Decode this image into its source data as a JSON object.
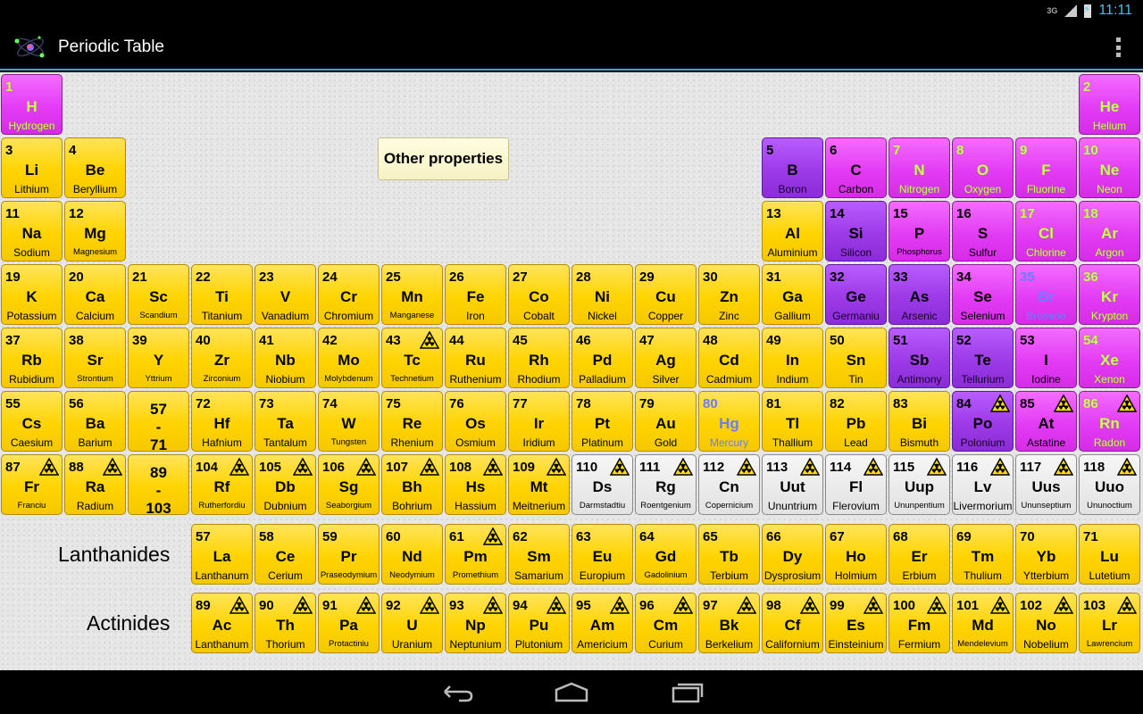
{
  "status": {
    "network": "3G",
    "time": "11:11"
  },
  "app": {
    "title": "Periodic Table"
  },
  "other_properties_label": "Other properties",
  "series": {
    "lanthanides": "Lanthanides",
    "actinides": "Actinides"
  },
  "elements": [
    {
      "n": "1",
      "s": "H",
      "name": "Hydrogen",
      "row": 0,
      "col": 0,
      "c": "magenta",
      "gas": true
    },
    {
      "n": "2",
      "s": "He",
      "name": "Helium",
      "row": 0,
      "col": 17,
      "c": "magenta",
      "gas": true
    },
    {
      "n": "3",
      "s": "Li",
      "name": "Lithium",
      "row": 1,
      "col": 0,
      "c": "yellow"
    },
    {
      "n": "4",
      "s": "Be",
      "name": "Beryllium",
      "row": 1,
      "col": 1,
      "c": "yellow"
    },
    {
      "n": "5",
      "s": "B",
      "name": "Boron",
      "row": 1,
      "col": 12,
      "c": "violet"
    },
    {
      "n": "6",
      "s": "C",
      "name": "Carbon",
      "row": 1,
      "col": 13,
      "c": "magenta"
    },
    {
      "n": "7",
      "s": "N",
      "name": "Nitrogen",
      "row": 1,
      "col": 14,
      "c": "magenta",
      "gas": true
    },
    {
      "n": "8",
      "s": "O",
      "name": "Oxygen",
      "row": 1,
      "col": 15,
      "c": "magenta",
      "gas": true
    },
    {
      "n": "9",
      "s": "F",
      "name": "Fluorine",
      "row": 1,
      "col": 16,
      "c": "magenta",
      "gas": true
    },
    {
      "n": "10",
      "s": "Ne",
      "name": "Neon",
      "row": 1,
      "col": 17,
      "c": "magenta",
      "gas": true
    },
    {
      "n": "11",
      "s": "Na",
      "name": "Sodium",
      "row": 2,
      "col": 0,
      "c": "yellow"
    },
    {
      "n": "12",
      "s": "Mg",
      "name": "Magnesium",
      "row": 2,
      "col": 1,
      "c": "yellow",
      "small": true
    },
    {
      "n": "13",
      "s": "Al",
      "name": "Aluminium",
      "row": 2,
      "col": 12,
      "c": "yellow"
    },
    {
      "n": "14",
      "s": "Si",
      "name": "Silicon",
      "row": 2,
      "col": 13,
      "c": "violet"
    },
    {
      "n": "15",
      "s": "P",
      "name": "Phosphorus",
      "row": 2,
      "col": 14,
      "c": "magenta",
      "small": true
    },
    {
      "n": "16",
      "s": "S",
      "name": "Sulfur",
      "row": 2,
      "col": 15,
      "c": "magenta"
    },
    {
      "n": "17",
      "s": "Cl",
      "name": "Chlorine",
      "row": 2,
      "col": 16,
      "c": "magenta",
      "gas": true
    },
    {
      "n": "18",
      "s": "Ar",
      "name": "Argon",
      "row": 2,
      "col": 17,
      "c": "magenta",
      "gas": true
    },
    {
      "n": "19",
      "s": "K",
      "name": "Potassium",
      "row": 3,
      "col": 0,
      "c": "yellow"
    },
    {
      "n": "20",
      "s": "Ca",
      "name": "Calcium",
      "row": 3,
      "col": 1,
      "c": "yellow"
    },
    {
      "n": "21",
      "s": "Sc",
      "name": "Scandium",
      "row": 3,
      "col": 2,
      "c": "yellow",
      "small": true
    },
    {
      "n": "22",
      "s": "Ti",
      "name": "Titanium",
      "row": 3,
      "col": 3,
      "c": "yellow"
    },
    {
      "n": "23",
      "s": "V",
      "name": "Vanadium",
      "row": 3,
      "col": 4,
      "c": "yellow"
    },
    {
      "n": "24",
      "s": "Cr",
      "name": "Chromium",
      "row": 3,
      "col": 5,
      "c": "yellow"
    },
    {
      "n": "25",
      "s": "Mn",
      "name": "Manganese",
      "row": 3,
      "col": 6,
      "c": "yellow",
      "small": true
    },
    {
      "n": "26",
      "s": "Fe",
      "name": "Iron",
      "row": 3,
      "col": 7,
      "c": "yellow"
    },
    {
      "n": "27",
      "s": "Co",
      "name": "Cobalt",
      "row": 3,
      "col": 8,
      "c": "yellow"
    },
    {
      "n": "28",
      "s": "Ni",
      "name": "Nickel",
      "row": 3,
      "col": 9,
      "c": "yellow"
    },
    {
      "n": "29",
      "s": "Cu",
      "name": "Copper",
      "row": 3,
      "col": 10,
      "c": "yellow"
    },
    {
      "n": "30",
      "s": "Zn",
      "name": "Zinc",
      "row": 3,
      "col": 11,
      "c": "yellow"
    },
    {
      "n": "31",
      "s": "Ga",
      "name": "Gallium",
      "row": 3,
      "col": 12,
      "c": "yellow"
    },
    {
      "n": "32",
      "s": "Ge",
      "name": "Germaniu",
      "row": 3,
      "col": 13,
      "c": "violet"
    },
    {
      "n": "33",
      "s": "As",
      "name": "Arsenic",
      "row": 3,
      "col": 14,
      "c": "violet"
    },
    {
      "n": "34",
      "s": "Se",
      "name": "Selenium",
      "row": 3,
      "col": 15,
      "c": "magenta"
    },
    {
      "n": "35",
      "s": "Br",
      "name": "Bromine",
      "row": 3,
      "col": 16,
      "c": "magenta",
      "liquid": true
    },
    {
      "n": "36",
      "s": "Kr",
      "name": "Krypton",
      "row": 3,
      "col": 17,
      "c": "magenta",
      "gas": true
    },
    {
      "n": "37",
      "s": "Rb",
      "name": "Rubidium",
      "row": 4,
      "col": 0,
      "c": "yellow"
    },
    {
      "n": "38",
      "s": "Sr",
      "name": "Strontium",
      "row": 4,
      "col": 1,
      "c": "yellow",
      "small": true
    },
    {
      "n": "39",
      "s": "Y",
      "name": "Yttrium",
      "row": 4,
      "col": 2,
      "c": "yellow",
      "small": true
    },
    {
      "n": "40",
      "s": "Zr",
      "name": "Zirconium",
      "row": 4,
      "col": 3,
      "c": "yellow",
      "small": true
    },
    {
      "n": "41",
      "s": "Nb",
      "name": "Niobium",
      "row": 4,
      "col": 4,
      "c": "yellow"
    },
    {
      "n": "42",
      "s": "Mo",
      "name": "Molybdenum",
      "row": 4,
      "col": 5,
      "c": "yellow",
      "small": true
    },
    {
      "n": "43",
      "s": "Tc",
      "name": "Technetium",
      "row": 4,
      "col": 6,
      "c": "yellow",
      "small": true,
      "rad": true
    },
    {
      "n": "44",
      "s": "Ru",
      "name": "Ruthenium",
      "row": 4,
      "col": 7,
      "c": "yellow"
    },
    {
      "n": "45",
      "s": "Rh",
      "name": "Rhodium",
      "row": 4,
      "col": 8,
      "c": "yellow"
    },
    {
      "n": "46",
      "s": "Pd",
      "name": "Palladium",
      "row": 4,
      "col": 9,
      "c": "yellow"
    },
    {
      "n": "47",
      "s": "Ag",
      "name": "Silver",
      "row": 4,
      "col": 10,
      "c": "yellow"
    },
    {
      "n": "48",
      "s": "Cd",
      "name": "Cadmium",
      "row": 4,
      "col": 11,
      "c": "yellow"
    },
    {
      "n": "49",
      "s": "In",
      "name": "Indium",
      "row": 4,
      "col": 12,
      "c": "yellow"
    },
    {
      "n": "50",
      "s": "Sn",
      "name": "Tin",
      "row": 4,
      "col": 13,
      "c": "yellow"
    },
    {
      "n": "51",
      "s": "Sb",
      "name": "Antimony",
      "row": 4,
      "col": 14,
      "c": "violet"
    },
    {
      "n": "52",
      "s": "Te",
      "name": "Tellurium",
      "row": 4,
      "col": 15,
      "c": "violet"
    },
    {
      "n": "53",
      "s": "I",
      "name": "Iodine",
      "row": 4,
      "col": 16,
      "c": "magenta"
    },
    {
      "n": "54",
      "s": "Xe",
      "name": "Xenon",
      "row": 4,
      "col": 17,
      "c": "magenta",
      "gas": true
    },
    {
      "n": "55",
      "s": "Cs",
      "name": "Caesium",
      "row": 5,
      "col": 0,
      "c": "yellow"
    },
    {
      "n": "56",
      "s": "Ba",
      "name": "Barium",
      "row": 5,
      "col": 1,
      "c": "yellow"
    },
    {
      "n": "57",
      "s": "-",
      "name": "",
      "row": 5,
      "col": 2,
      "c": "yellow",
      "range": "57\n-\n71"
    },
    {
      "n": "72",
      "s": "Hf",
      "name": "Hafnium",
      "row": 5,
      "col": 3,
      "c": "yellow"
    },
    {
      "n": "73",
      "s": "Ta",
      "name": "Tantalum",
      "row": 5,
      "col": 4,
      "c": "yellow"
    },
    {
      "n": "74",
      "s": "W",
      "name": "Tungsten",
      "row": 5,
      "col": 5,
      "c": "yellow",
      "small": true
    },
    {
      "n": "75",
      "s": "Re",
      "name": "Rhenium",
      "row": 5,
      "col": 6,
      "c": "yellow"
    },
    {
      "n": "76",
      "s": "Os",
      "name": "Osmium",
      "row": 5,
      "col": 7,
      "c": "yellow"
    },
    {
      "n": "77",
      "s": "Ir",
      "name": "Iridium",
      "row": 5,
      "col": 8,
      "c": "yellow"
    },
    {
      "n": "78",
      "s": "Pt",
      "name": "Platinum",
      "row": 5,
      "col": 9,
      "c": "yellow"
    },
    {
      "n": "79",
      "s": "Au",
      "name": "Gold",
      "row": 5,
      "col": 10,
      "c": "yellow"
    },
    {
      "n": "80",
      "s": "Hg",
      "name": "Mercury",
      "row": 5,
      "col": 11,
      "c": "yellow",
      "liquid": true
    },
    {
      "n": "81",
      "s": "Tl",
      "name": "Thallium",
      "row": 5,
      "col": 12,
      "c": "yellow"
    },
    {
      "n": "82",
      "s": "Pb",
      "name": "Lead",
      "row": 5,
      "col": 13,
      "c": "yellow"
    },
    {
      "n": "83",
      "s": "Bi",
      "name": "Bismuth",
      "row": 5,
      "col": 14,
      "c": "yellow"
    },
    {
      "n": "84",
      "s": "Po",
      "name": "Polonium",
      "row": 5,
      "col": 15,
      "c": "violet",
      "rad": true
    },
    {
      "n": "85",
      "s": "At",
      "name": "Astatine",
      "row": 5,
      "col": 16,
      "c": "magenta",
      "rad": true
    },
    {
      "n": "86",
      "s": "Rn",
      "name": "Radon",
      "row": 5,
      "col": 17,
      "c": "magenta",
      "gas": true,
      "rad": true
    },
    {
      "n": "87",
      "s": "Fr",
      "name": "Franciu",
      "row": 6,
      "col": 0,
      "c": "yellow",
      "small": true,
      "rad": true
    },
    {
      "n": "88",
      "s": "Ra",
      "name": "Radium",
      "row": 6,
      "col": 1,
      "c": "yellow",
      "rad": true
    },
    {
      "n": "89",
      "s": "-",
      "name": "",
      "row": 6,
      "col": 2,
      "c": "yellow",
      "range": "89\n-\n103"
    },
    {
      "n": "104",
      "s": "Rf",
      "name": "Rutherfordiu",
      "row": 6,
      "col": 3,
      "c": "yellow",
      "small": true,
      "rad": true
    },
    {
      "n": "105",
      "s": "Db",
      "name": "Dubnium",
      "row": 6,
      "col": 4,
      "c": "yellow",
      "rad": true
    },
    {
      "n": "106",
      "s": "Sg",
      "name": "Seaborgium",
      "row": 6,
      "col": 5,
      "c": "yellow",
      "small": true,
      "rad": true
    },
    {
      "n": "107",
      "s": "Bh",
      "name": "Bohrium",
      "row": 6,
      "col": 6,
      "c": "yellow",
      "rad": true
    },
    {
      "n": "108",
      "s": "Hs",
      "name": "Hassium",
      "row": 6,
      "col": 7,
      "c": "yellow",
      "rad": true
    },
    {
      "n": "109",
      "s": "Mt",
      "name": "Meitnerium",
      "row": 6,
      "col": 8,
      "c": "yellow",
      "rad": true
    },
    {
      "n": "110",
      "s": "Ds",
      "name": "Darmstadtiu",
      "row": 6,
      "col": 9,
      "c": "gray",
      "small": true,
      "rad": true
    },
    {
      "n": "111",
      "s": "Rg",
      "name": "Roentgenium",
      "row": 6,
      "col": 10,
      "c": "gray",
      "small": true,
      "rad": true
    },
    {
      "n": "112",
      "s": "Cn",
      "name": "Copernicium",
      "row": 6,
      "col": 11,
      "c": "gray",
      "small": true,
      "rad": true
    },
    {
      "n": "113",
      "s": "Uut",
      "name": "Ununtrium",
      "row": 6,
      "col": 12,
      "c": "gray",
      "rad": true
    },
    {
      "n": "114",
      "s": "Fl",
      "name": "Flerovium",
      "row": 6,
      "col": 13,
      "c": "gray",
      "rad": true
    },
    {
      "n": "115",
      "s": "Uup",
      "name": "Ununpentium",
      "row": 6,
      "col": 14,
      "c": "gray",
      "small": true,
      "rad": true
    },
    {
      "n": "116",
      "s": "Lv",
      "name": "Livermorium",
      "row": 6,
      "col": 15,
      "c": "gray",
      "rad": true
    },
    {
      "n": "117",
      "s": "Uus",
      "name": "Ununseptium",
      "row": 6,
      "col": 16,
      "c": "gray",
      "small": true,
      "rad": true
    },
    {
      "n": "118",
      "s": "Uuo",
      "name": "Ununoctium",
      "row": 6,
      "col": 17,
      "c": "gray",
      "small": true,
      "rad": true
    },
    {
      "n": "57",
      "s": "La",
      "name": "Lanthanum",
      "row": 7,
      "col": 3,
      "c": "yellow"
    },
    {
      "n": "58",
      "s": "Ce",
      "name": "Cerium",
      "row": 7,
      "col": 4,
      "c": "yellow"
    },
    {
      "n": "59",
      "s": "Pr",
      "name": "Praseodymium",
      "row": 7,
      "col": 5,
      "c": "yellow",
      "small": true
    },
    {
      "n": "60",
      "s": "Nd",
      "name": "Neodymium",
      "row": 7,
      "col": 6,
      "c": "yellow",
      "small": true
    },
    {
      "n": "61",
      "s": "Pm",
      "name": "Promethium",
      "row": 7,
      "col": 7,
      "c": "yellow",
      "small": true,
      "rad": true
    },
    {
      "n": "62",
      "s": "Sm",
      "name": "Samarium",
      "row": 7,
      "col": 8,
      "c": "yellow"
    },
    {
      "n": "63",
      "s": "Eu",
      "name": "Europium",
      "row": 7,
      "col": 9,
      "c": "yellow"
    },
    {
      "n": "64",
      "s": "Gd",
      "name": "Gadolinium",
      "row": 7,
      "col": 10,
      "c": "yellow",
      "small": true
    },
    {
      "n": "65",
      "s": "Tb",
      "name": "Terbium",
      "row": 7,
      "col": 11,
      "c": "yellow"
    },
    {
      "n": "66",
      "s": "Dy",
      "name": "Dysprosium",
      "row": 7,
      "col": 12,
      "c": "yellow"
    },
    {
      "n": "67",
      "s": "Ho",
      "name": "Holmium",
      "row": 7,
      "col": 13,
      "c": "yellow"
    },
    {
      "n": "68",
      "s": "Er",
      "name": "Erbium",
      "row": 7,
      "col": 14,
      "c": "yellow"
    },
    {
      "n": "69",
      "s": "Tm",
      "name": "Thulium",
      "row": 7,
      "col": 15,
      "c": "yellow"
    },
    {
      "n": "70",
      "s": "Yb",
      "name": "Ytterbium",
      "row": 7,
      "col": 16,
      "c": "yellow"
    },
    {
      "n": "71",
      "s": "Lu",
      "name": "Lutetium",
      "row": 7,
      "col": 17,
      "c": "yellow"
    },
    {
      "n": "89",
      "s": "Ac",
      "name": "Lanthanum",
      "row": 8,
      "col": 3,
      "c": "yellow",
      "rad": true
    },
    {
      "n": "90",
      "s": "Th",
      "name": "Thorium",
      "row": 8,
      "col": 4,
      "c": "yellow",
      "rad": true
    },
    {
      "n": "91",
      "s": "Pa",
      "name": "Protactiniu",
      "row": 8,
      "col": 5,
      "c": "yellow",
      "small": true,
      "rad": true
    },
    {
      "n": "92",
      "s": "U",
      "name": "Uranium",
      "row": 8,
      "col": 6,
      "c": "yellow",
      "rad": true
    },
    {
      "n": "93",
      "s": "Np",
      "name": "Neptunium",
      "row": 8,
      "col": 7,
      "c": "yellow",
      "rad": true
    },
    {
      "n": "94",
      "s": "Pu",
      "name": "Plutonium",
      "row": 8,
      "col": 8,
      "c": "yellow",
      "rad": true
    },
    {
      "n": "95",
      "s": "Am",
      "name": "Americium",
      "row": 8,
      "col": 9,
      "c": "yellow",
      "rad": true
    },
    {
      "n": "96",
      "s": "Cm",
      "name": "Curium",
      "row": 8,
      "col": 10,
      "c": "yellow",
      "rad": true
    },
    {
      "n": "97",
      "s": "Bk",
      "name": "Berkelium",
      "row": 8,
      "col": 11,
      "c": "yellow",
      "rad": true
    },
    {
      "n": "98",
      "s": "Cf",
      "name": "Californium",
      "row": 8,
      "col": 12,
      "c": "yellow",
      "rad": true
    },
    {
      "n": "99",
      "s": "Es",
      "name": "Einsteinium",
      "row": 8,
      "col": 13,
      "c": "yellow",
      "rad": true
    },
    {
      "n": "100",
      "s": "Fm",
      "name": "Fermium",
      "row": 8,
      "col": 14,
      "c": "yellow",
      "rad": true
    },
    {
      "n": "101",
      "s": "Md",
      "name": "Mendelevium",
      "row": 8,
      "col": 15,
      "c": "yellow",
      "small": true,
      "rad": true
    },
    {
      "n": "102",
      "s": "No",
      "name": "Nobelium",
      "row": 8,
      "col": 16,
      "c": "yellow",
      "rad": true
    },
    {
      "n": "103",
      "s": "Lr",
      "name": "Lawrencium",
      "row": 8,
      "col": 17,
      "c": "yellow",
      "small": true,
      "rad": true
    }
  ],
  "icons": {
    "app": "atom-icon",
    "overflow": "overflow-menu-icon",
    "radioactive": "radioactive-icon",
    "back": "back-icon",
    "home": "home-icon",
    "recents": "recent-apps-icon"
  }
}
